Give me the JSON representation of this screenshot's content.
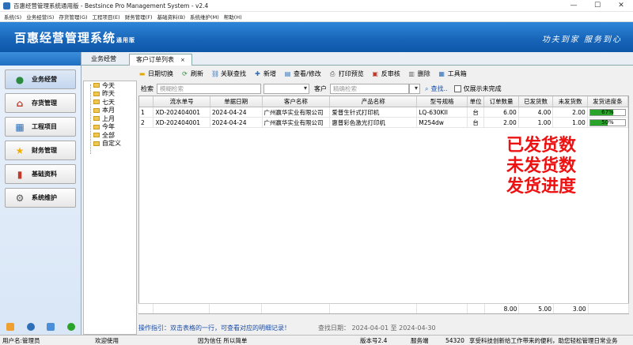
{
  "window": {
    "title": "百惠经营管理系统通用版 - Bestsince Pro Management System - v2.4",
    "controls": [
      "—",
      "☐",
      "✕"
    ]
  },
  "menu": [
    "系统(S)",
    "业务经营(S)",
    "存货管理(G)",
    "工程项目(E)",
    "财务管理(F)",
    "基础资料(B)",
    "系统维护(M)",
    "帮助(H)"
  ],
  "banner": {
    "logo": "百惠经营管理系统",
    "logo_sub": "通用版",
    "slogan": "功夫到家  服务到心"
  },
  "nav": [
    {
      "label": "业务经营",
      "icon": "business-icon",
      "color": "#2b8a3e"
    },
    {
      "label": "存货管理",
      "icon": "warehouse-icon",
      "color": "#c0392b"
    },
    {
      "label": "工程项目",
      "icon": "project-icon",
      "color": "#2d6fb8"
    },
    {
      "label": "财务管理",
      "icon": "finance-icon",
      "color": "#f1b000"
    },
    {
      "label": "基础资料",
      "icon": "book-icon",
      "color": "#c0392b"
    },
    {
      "label": "系统维护",
      "icon": "gear-icon",
      "color": "#555555"
    }
  ],
  "tabs": {
    "t1": "业务经营",
    "t2": "客户订单列表",
    "close": "×"
  },
  "toolbar": [
    {
      "label": "日期切换",
      "icon": "folder-icon",
      "color": "#e6a800"
    },
    {
      "label": "刷新",
      "icon": "refresh-icon",
      "color": "#2b8a3e"
    },
    {
      "label": "关联查找",
      "icon": "link-icon",
      "color": "#2d6fb8"
    },
    {
      "label": "新增",
      "icon": "add-icon",
      "color": "#2d6fb8"
    },
    {
      "label": "查看/修改",
      "icon": "edit-icon",
      "color": "#2d6fb8"
    },
    {
      "label": "打印预览",
      "icon": "print-icon",
      "color": "#555555"
    },
    {
      "label": "反审核",
      "icon": "unaudit-icon",
      "color": "#c0392b"
    },
    {
      "label": "删除",
      "icon": "delete-icon",
      "color": "#666666"
    },
    {
      "label": "工具箱",
      "icon": "toolbox-icon",
      "color": "#2d6fb8"
    }
  ],
  "tree": [
    "今天",
    "昨天",
    "七天",
    "本月",
    "上月",
    "今年",
    "全部",
    "自定义"
  ],
  "filter": {
    "label1": "检索",
    "ph1": "模糊检索",
    "label2": "客户",
    "ph2": "精确检索",
    "search": "查找..",
    "check": "仅展示未完成"
  },
  "table": {
    "headers": [
      "",
      "流水单号",
      "单据日期",
      "客户名称",
      "产品名称",
      "型号规格",
      "单位",
      "订单数量",
      "已发货数",
      "未发货数",
      "发货进度条"
    ],
    "rows": [
      {
        "no": "1",
        "serial": "XD-202404001",
        "date": "2024-04-24",
        "customer": "广州嬴华实业有限公司",
        "product": "爱普生针式打印机",
        "model": "LQ-630KII",
        "unit": "台",
        "qty": "6.00",
        "shipped": "4.00",
        "pending": "2.00",
        "progress": 67,
        "progress_text": "67%"
      },
      {
        "no": "2",
        "serial": "XD-202404001",
        "date": "2024-04-24",
        "customer": "广州嬴华实业有限公司",
        "product": "惠普彩色激光打印机",
        "model": "M254dw",
        "unit": "台",
        "qty": "2.00",
        "shipped": "1.00",
        "pending": "1.00",
        "progress": 50,
        "progress_text": "50%"
      }
    ],
    "totals": {
      "qty": "8.00",
      "shipped": "5.00",
      "pending": "3.00"
    }
  },
  "overlay": [
    "已发货数",
    "未发货数",
    "发货进度"
  ],
  "hint": {
    "text": "操作指引：双击表格的一行，可查看对应的明细记录！",
    "dates": "查找日期：  2024-04-01 至 2024-04-30"
  },
  "status": {
    "user": "用户名:管理员",
    "welcome": "欢迎使用",
    "motto": "因为信任  所以简单",
    "version": "版本号2.4",
    "server_label": "服务端",
    "port": "54320",
    "note": "享受科技创新给工作带来的便利，助您轻松管理日常业务"
  }
}
